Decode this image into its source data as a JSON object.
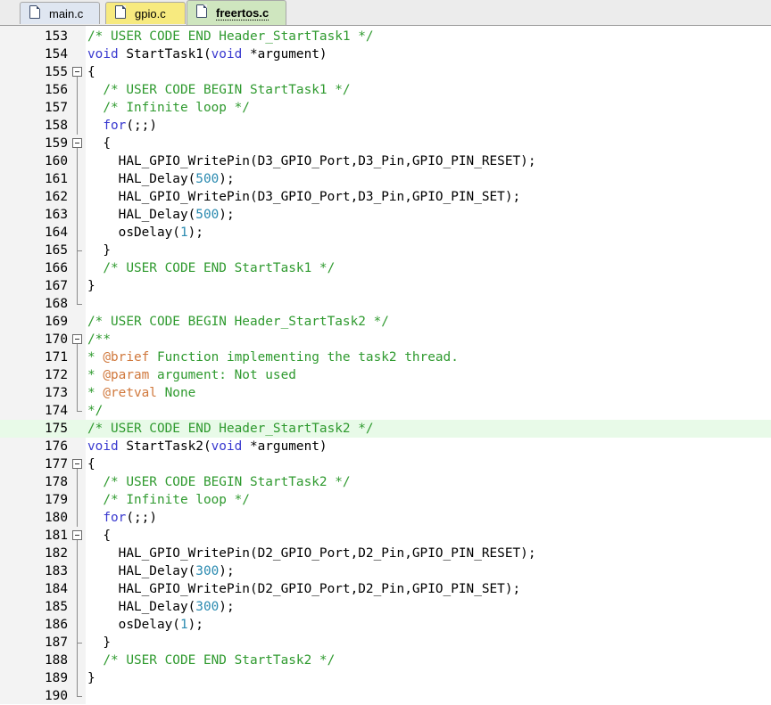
{
  "tabs": [
    {
      "id": "main",
      "label": "main.c",
      "active": false,
      "color": "#dfe6f1"
    },
    {
      "id": "gpio",
      "label": "gpio.c",
      "active": false,
      "color": "#f7ea7f"
    },
    {
      "id": "freertos",
      "label": "freertos.c",
      "active": true,
      "color": "#cfe6bf"
    }
  ],
  "colors": {
    "comment": "#2f9a2f",
    "keyword": "#3939cf",
    "number": "#2a8ab0",
    "doc_tag": "#d0783c",
    "highlight_line": "#e8fae8"
  },
  "editor": {
    "highlighted_line": 175,
    "lines": [
      {
        "n": "153",
        "fold": "line",
        "tokens": [
          {
            "t": "/* USER CODE END Header_StartTask1 */",
            "c": "cm"
          }
        ]
      },
      {
        "n": "154",
        "fold": "line",
        "tokens": [
          {
            "t": "void",
            "c": "kw"
          },
          {
            "t": " StartTask1("
          },
          {
            "t": "void",
            "c": "kw"
          },
          {
            "t": " *argument)"
          }
        ]
      },
      {
        "n": "155",
        "fold": "box",
        "tokens": [
          {
            "t": "{"
          }
        ]
      },
      {
        "n": "156",
        "fold": "vline",
        "tokens": [
          {
            "t": "  "
          },
          {
            "t": "/* USER CODE BEGIN StartTask1 */",
            "c": "cm"
          }
        ]
      },
      {
        "n": "157",
        "fold": "vline",
        "tokens": [
          {
            "t": "  "
          },
          {
            "t": "/* Infinite loop */",
            "c": "cm"
          }
        ]
      },
      {
        "n": "158",
        "fold": "vline",
        "tokens": [
          {
            "t": "  "
          },
          {
            "t": "for",
            "c": "kw"
          },
          {
            "t": "(;;)"
          }
        ]
      },
      {
        "n": "159",
        "fold": "box",
        "tokens": [
          {
            "t": "  {"
          }
        ]
      },
      {
        "n": "160",
        "fold": "vline",
        "tokens": [
          {
            "t": "    HAL_GPIO_WritePin(D3_GPIO_Port,D3_Pin,GPIO_PIN_RESET);"
          }
        ]
      },
      {
        "n": "161",
        "fold": "vline",
        "tokens": [
          {
            "t": "    HAL_Delay("
          },
          {
            "t": "500",
            "c": "nm"
          },
          {
            "t": ");"
          }
        ]
      },
      {
        "n": "162",
        "fold": "vline",
        "tokens": [
          {
            "t": "    HAL_GPIO_WritePin(D3_GPIO_Port,D3_Pin,GPIO_PIN_SET);"
          }
        ]
      },
      {
        "n": "163",
        "fold": "vline",
        "tokens": [
          {
            "t": "    HAL_Delay("
          },
          {
            "t": "500",
            "c": "nm"
          },
          {
            "t": ");"
          }
        ]
      },
      {
        "n": "164",
        "fold": "vline",
        "tokens": [
          {
            "t": "    osDelay("
          },
          {
            "t": "1",
            "c": "nm"
          },
          {
            "t": ");"
          }
        ]
      },
      {
        "n": "165",
        "fold": "tee",
        "tokens": [
          {
            "t": "  }"
          }
        ]
      },
      {
        "n": "166",
        "fold": "vline",
        "tokens": [
          {
            "t": "  "
          },
          {
            "t": "/* USER CODE END StartTask1 */",
            "c": "cm"
          }
        ]
      },
      {
        "n": "167",
        "fold": "vline",
        "tokens": [
          {
            "t": "}"
          }
        ]
      },
      {
        "n": "168",
        "fold": "end",
        "tokens": []
      },
      {
        "n": "169",
        "fold": "none",
        "tokens": [
          {
            "t": "/* USER CODE BEGIN Header_StartTask2 */",
            "c": "cm"
          }
        ]
      },
      {
        "n": "170",
        "fold": "box",
        "tokens": [
          {
            "t": "/**",
            "c": "cm"
          }
        ]
      },
      {
        "n": "171",
        "fold": "vline",
        "tokens": [
          {
            "t": "* ",
            "c": "cm"
          },
          {
            "t": "@brief",
            "c": "dk"
          },
          {
            "t": " Function implementing the task2 thread.",
            "c": "cm"
          }
        ]
      },
      {
        "n": "172",
        "fold": "vline",
        "tokens": [
          {
            "t": "* ",
            "c": "cm"
          },
          {
            "t": "@param",
            "c": "dk"
          },
          {
            "t": " argument: Not used",
            "c": "cm"
          }
        ]
      },
      {
        "n": "173",
        "fold": "vline",
        "tokens": [
          {
            "t": "* ",
            "c": "cm"
          },
          {
            "t": "@retval",
            "c": "dk"
          },
          {
            "t": " None",
            "c": "cm"
          }
        ]
      },
      {
        "n": "174",
        "fold": "end",
        "tokens": [
          {
            "t": "*/",
            "c": "cm"
          }
        ]
      },
      {
        "n": "175",
        "fold": "none",
        "tokens": [
          {
            "t": "/* USER CODE END Header_StartTask2 */",
            "c": "cm"
          }
        ]
      },
      {
        "n": "176",
        "fold": "none",
        "tokens": [
          {
            "t": "void",
            "c": "kw"
          },
          {
            "t": " StartTask2("
          },
          {
            "t": "void",
            "c": "kw"
          },
          {
            "t": " *argument)"
          }
        ]
      },
      {
        "n": "177",
        "fold": "box",
        "tokens": [
          {
            "t": "{"
          }
        ]
      },
      {
        "n": "178",
        "fold": "vline",
        "tokens": [
          {
            "t": "  "
          },
          {
            "t": "/* USER CODE BEGIN StartTask2 */",
            "c": "cm"
          }
        ]
      },
      {
        "n": "179",
        "fold": "vline",
        "tokens": [
          {
            "t": "  "
          },
          {
            "t": "/* Infinite loop */",
            "c": "cm"
          }
        ]
      },
      {
        "n": "180",
        "fold": "vline",
        "tokens": [
          {
            "t": "  "
          },
          {
            "t": "for",
            "c": "kw"
          },
          {
            "t": "(;;)"
          }
        ]
      },
      {
        "n": "181",
        "fold": "box",
        "tokens": [
          {
            "t": "  {"
          }
        ]
      },
      {
        "n": "182",
        "fold": "vline",
        "tokens": [
          {
            "t": "    HAL_GPIO_WritePin(D2_GPIO_Port,D2_Pin,GPIO_PIN_RESET);"
          }
        ]
      },
      {
        "n": "183",
        "fold": "vline",
        "tokens": [
          {
            "t": "    HAL_Delay("
          },
          {
            "t": "300",
            "c": "nm"
          },
          {
            "t": ");"
          }
        ]
      },
      {
        "n": "184",
        "fold": "vline",
        "tokens": [
          {
            "t": "    HAL_GPIO_WritePin(D2_GPIO_Port,D2_Pin,GPIO_PIN_SET);"
          }
        ]
      },
      {
        "n": "185",
        "fold": "vline",
        "tokens": [
          {
            "t": "    HAL_Delay("
          },
          {
            "t": "300",
            "c": "nm"
          },
          {
            "t": ");"
          }
        ]
      },
      {
        "n": "186",
        "fold": "vline",
        "tokens": [
          {
            "t": "    osDelay("
          },
          {
            "t": "1",
            "c": "nm"
          },
          {
            "t": ");"
          }
        ]
      },
      {
        "n": "187",
        "fold": "tee",
        "tokens": [
          {
            "t": "  }"
          }
        ]
      },
      {
        "n": "188",
        "fold": "vline",
        "tokens": [
          {
            "t": "  "
          },
          {
            "t": "/* USER CODE END StartTask2 */",
            "c": "cm"
          }
        ]
      },
      {
        "n": "189",
        "fold": "vline",
        "tokens": [
          {
            "t": "}"
          }
        ]
      },
      {
        "n": "190",
        "fold": "end",
        "tokens": []
      }
    ]
  }
}
